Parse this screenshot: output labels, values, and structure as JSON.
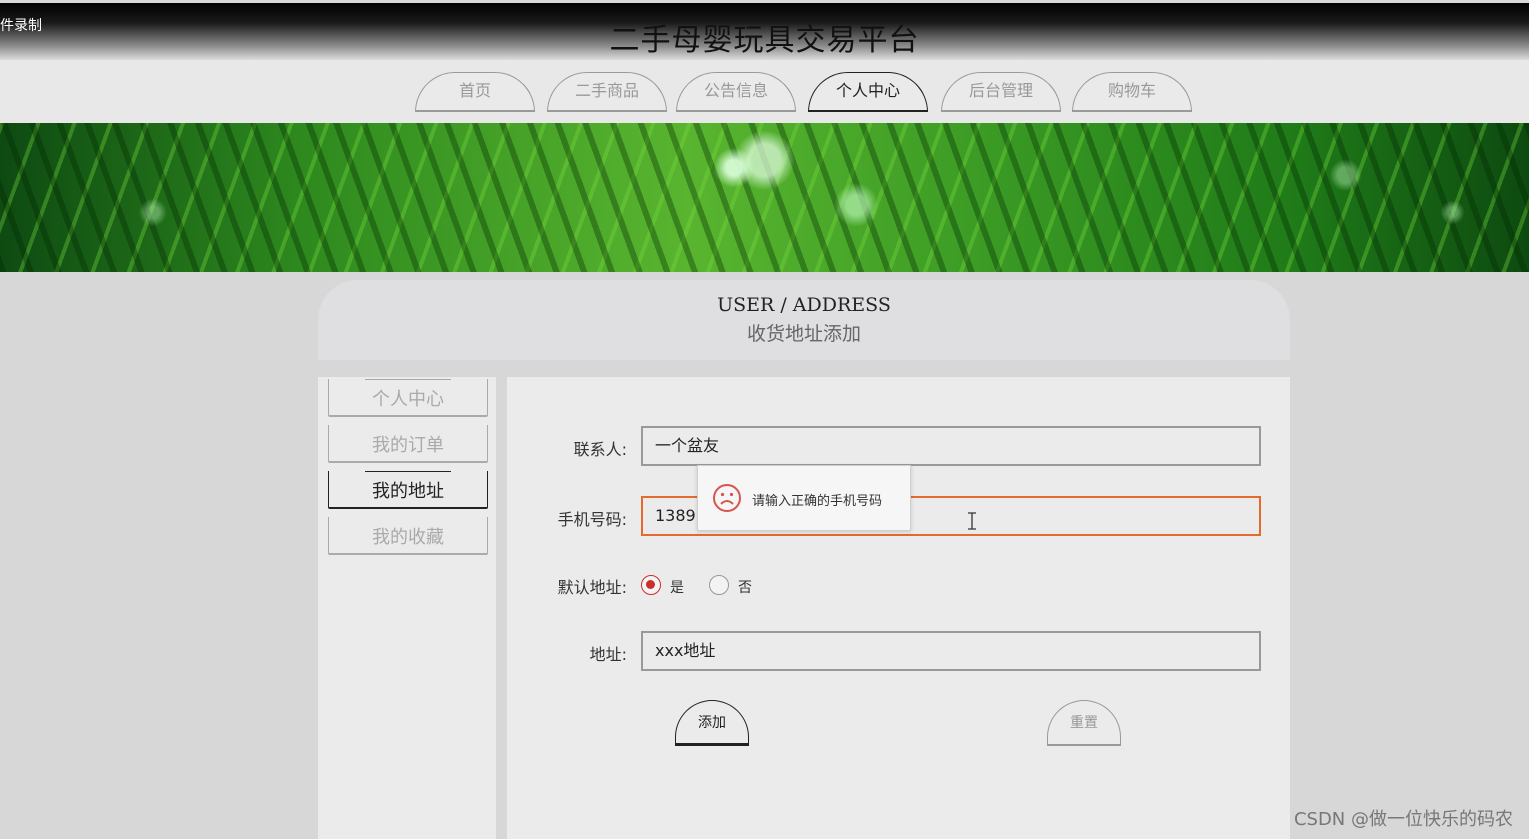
{
  "recording_label": "件录制",
  "site_title": "二手母婴玩具交易平台",
  "nav": [
    {
      "label": "首页",
      "active": false
    },
    {
      "label": "二手商品",
      "active": false
    },
    {
      "label": "公告信息",
      "active": false
    },
    {
      "label": "个人中心",
      "active": true
    },
    {
      "label": "后台管理",
      "active": false
    },
    {
      "label": "购物车",
      "active": false
    }
  ],
  "section": {
    "en": "USER / ADDRESS",
    "cn": "收货地址添加"
  },
  "sidebar": [
    {
      "label": "个人中心",
      "active": false
    },
    {
      "label": "我的订单",
      "active": false
    },
    {
      "label": "我的地址",
      "active": true
    },
    {
      "label": "我的收藏",
      "active": false
    }
  ],
  "form": {
    "contact_label": "联系人:",
    "contact_value": "一个盆友",
    "phone_label": "手机号码:",
    "phone_value": "1389",
    "default_label": "默认地址:",
    "default_yes": "是",
    "default_no": "否",
    "default_selected": "是",
    "address_label": "地址:",
    "address_value": "xxx地址",
    "error_message": "请输入正确的手机号码",
    "submit_label": "添加",
    "reset_label": "重置"
  },
  "colors": {
    "error_border": "#e46a2d",
    "radio_checked": "#c9302c"
  },
  "watermark": "CSDN @做一位快乐的码农"
}
